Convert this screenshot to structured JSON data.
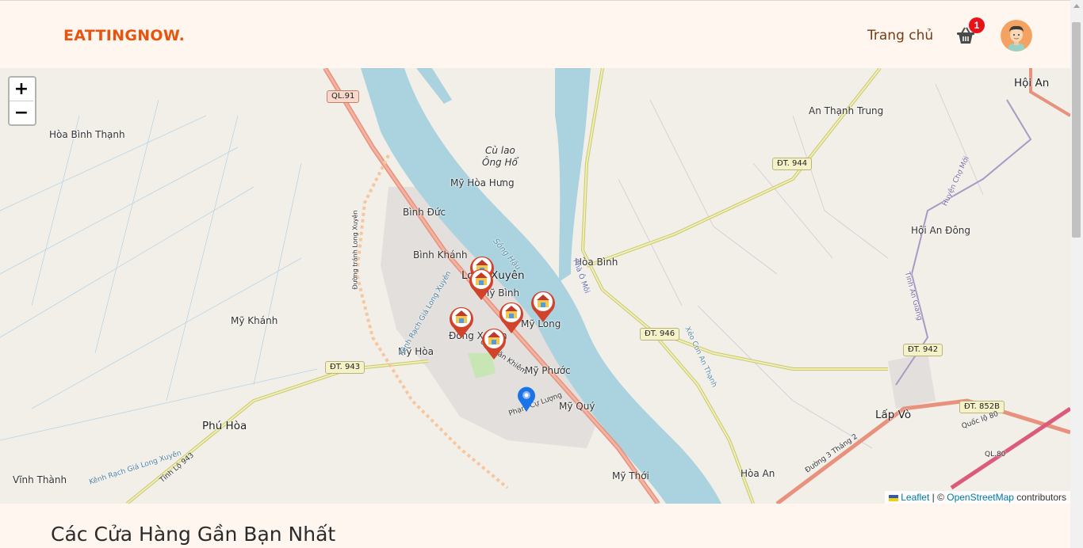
{
  "header": {
    "brand": "EATTINGNOW.",
    "nav_home": "Trang chủ",
    "cart_count": "1",
    "cart_icon": "basket-icon",
    "avatar_icon": "user-avatar-icon"
  },
  "map": {
    "zoom_in": "+",
    "zoom_out": "−",
    "places": [
      "Hòa Bình Thạnh",
      "Cù lao",
      "Ông Hổ",
      "Mỹ Hòa Hưng",
      "Bình Đức",
      "Bình Khánh",
      "Long Xuyên",
      "Mỹ Bình",
      "Mỹ Long",
      "Đông Xuyên",
      "Mỹ Hòa",
      "Mỹ Phước",
      "Mỹ Quý",
      "Mỹ Khánh",
      "Phú Hòa",
      "Vĩnh Thành",
      "Mỹ Thới",
      "Hòa Bình",
      "An Thạnh Trung",
      "Hội An",
      "Hội An Đông",
      "Lấp Vò",
      "Hòa An"
    ],
    "road_labels": [
      "QL.91",
      "ĐT. 944",
      "ĐT. 946",
      "ĐT. 943",
      "ĐT. 942",
      "ĐT. 852B"
    ],
    "street_labels": [
      "Sông Hậu",
      "Phà Ô Môi",
      "Kênh Rạch Giá Long Xuyên",
      "Đường tránh Long Xuyên",
      "Ung Văn Khiêm",
      "Phạm Cự Lượng",
      "Huyện Chợ Mới",
      "Tỉnh An Giang",
      "Tỉnh Lộ 943",
      "Kênh Rạch Giá Long Xuyên",
      "Đường 3 Tháng 2",
      "Quốc lộ 80",
      "QL.80",
      "Xẻo Con An Thạnh"
    ],
    "markers": [
      "store-marker",
      "store-marker",
      "store-marker",
      "store-marker",
      "store-marker",
      "store-marker"
    ],
    "current_location": "location-pin",
    "attribution": {
      "leaflet": "Leaflet",
      "sep": " | © ",
      "osm": "OpenStreetMap",
      "rest": " contributors"
    }
  },
  "section": {
    "title": "Các Cửa Hàng Gần Bạn Nhất"
  },
  "colors": {
    "brand": "#e8540f",
    "water": "#aad3df",
    "marker": "#d2432b",
    "pin": "#1a73e8"
  }
}
